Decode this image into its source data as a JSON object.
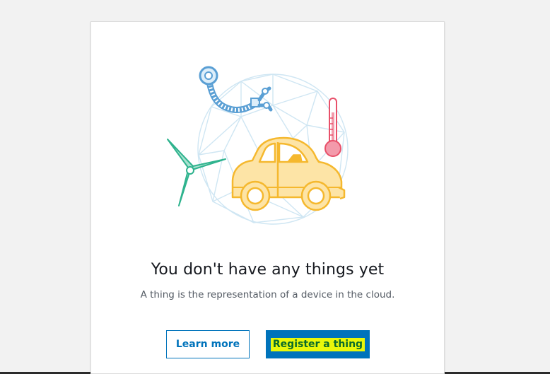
{
  "empty_state": {
    "title": "You don't have any things yet",
    "description": "A thing is the representation of a device in the cloud."
  },
  "actions": {
    "learn_more_label": "Learn more",
    "register_label": "Register a thing"
  },
  "illustration": {
    "icons": [
      "robot-arm-icon",
      "wind-turbine-icon",
      "car-icon",
      "thermometer-icon",
      "geodesic-sphere-icon"
    ],
    "colors": {
      "sphere": "#cfe6f3",
      "robot_arm": "#5a9fd4",
      "turbine": "#2fb38e",
      "car_fill": "#fde4a6",
      "car_stroke": "#f5b82e",
      "thermometer": "#e8506a"
    }
  },
  "colors": {
    "primary": "#0073bb",
    "highlight": "#e9f70a"
  }
}
